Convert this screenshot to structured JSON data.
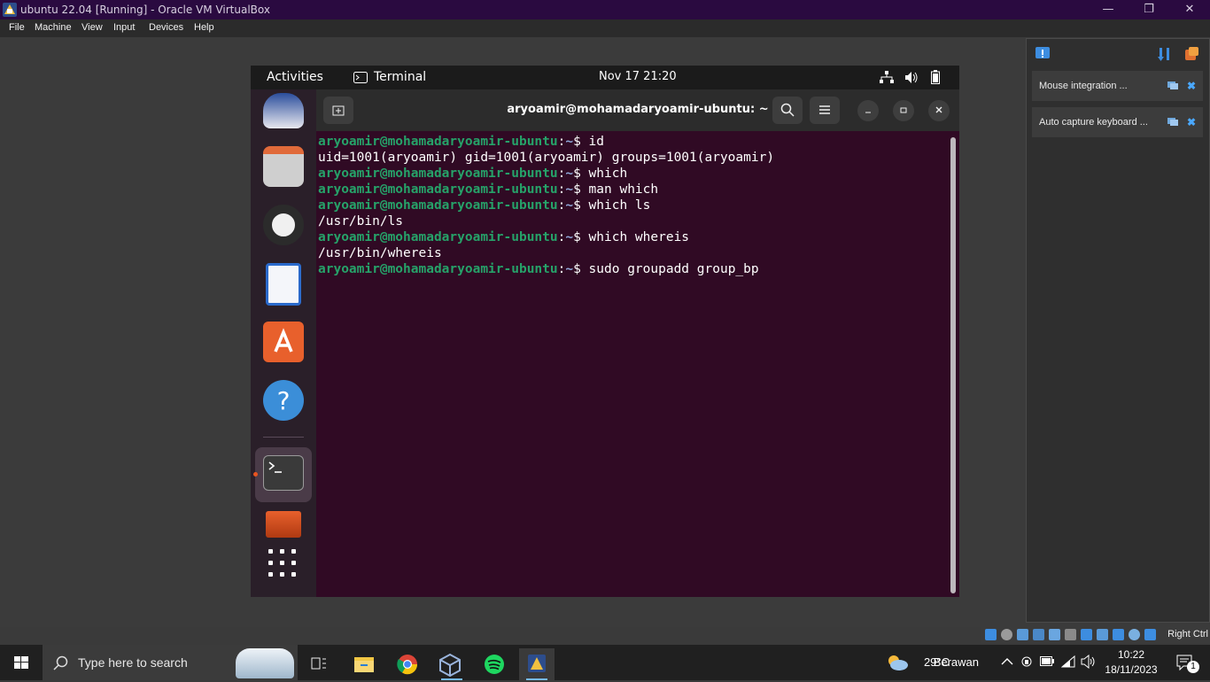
{
  "window": {
    "title": "ubuntu 22.04 [Running] - Oracle VM VirtualBox",
    "controls": {
      "minimize": "—",
      "restore": "❐",
      "close": "✕"
    }
  },
  "menubar": [
    "File",
    "Machine",
    "View",
    "Input",
    "Devices",
    "Help"
  ],
  "notifications": {
    "items": [
      {
        "label": "Mouse integration ..."
      },
      {
        "label": "Auto capture keyboard ..."
      }
    ],
    "close_glyph": "✖"
  },
  "vbox_status": {
    "host_key": "Right Ctrl"
  },
  "gnome": {
    "activities": "Activities",
    "app_name": "Terminal",
    "clock": "Nov 17  21:20"
  },
  "terminal": {
    "title": "aryoamir@mohamadaryoamir-ubuntu: ~",
    "lines": [
      {
        "prompt": "aryoamir@mohamadaryoamir-ubuntu",
        "path": "~",
        "cmd": "id"
      },
      {
        "out": "uid=1001(aryoamir) gid=1001(aryoamir) groups=1001(aryoamir)"
      },
      {
        "prompt": "aryoamir@mohamadaryoamir-ubuntu",
        "path": "~",
        "cmd": "which"
      },
      {
        "prompt": "aryoamir@mohamadaryoamir-ubuntu",
        "path": "~",
        "cmd": "man which"
      },
      {
        "prompt": "aryoamir@mohamadaryoamir-ubuntu",
        "path": "~",
        "cmd": "which ls"
      },
      {
        "out": "/usr/bin/ls"
      },
      {
        "prompt": "aryoamir@mohamadaryoamir-ubuntu",
        "path": "~",
        "cmd": "which whereis"
      },
      {
        "out": "/usr/bin/whereis"
      },
      {
        "prompt": "aryoamir@mohamadaryoamir-ubuntu",
        "path": "~",
        "cmd": "sudo groupadd group_bp"
      }
    ]
  },
  "taskbar": {
    "search_placeholder": "Type here to search",
    "weather_temp": "29°C",
    "weather_text": "Berawan",
    "time": "10:22",
    "date": "18/11/2023",
    "notification_count": "1"
  },
  "colors": {
    "terminal_bg": "#300a24",
    "prompt_green": "#26a269",
    "prompt_blue": "#12488b",
    "titlebar": "#2a0a40"
  }
}
